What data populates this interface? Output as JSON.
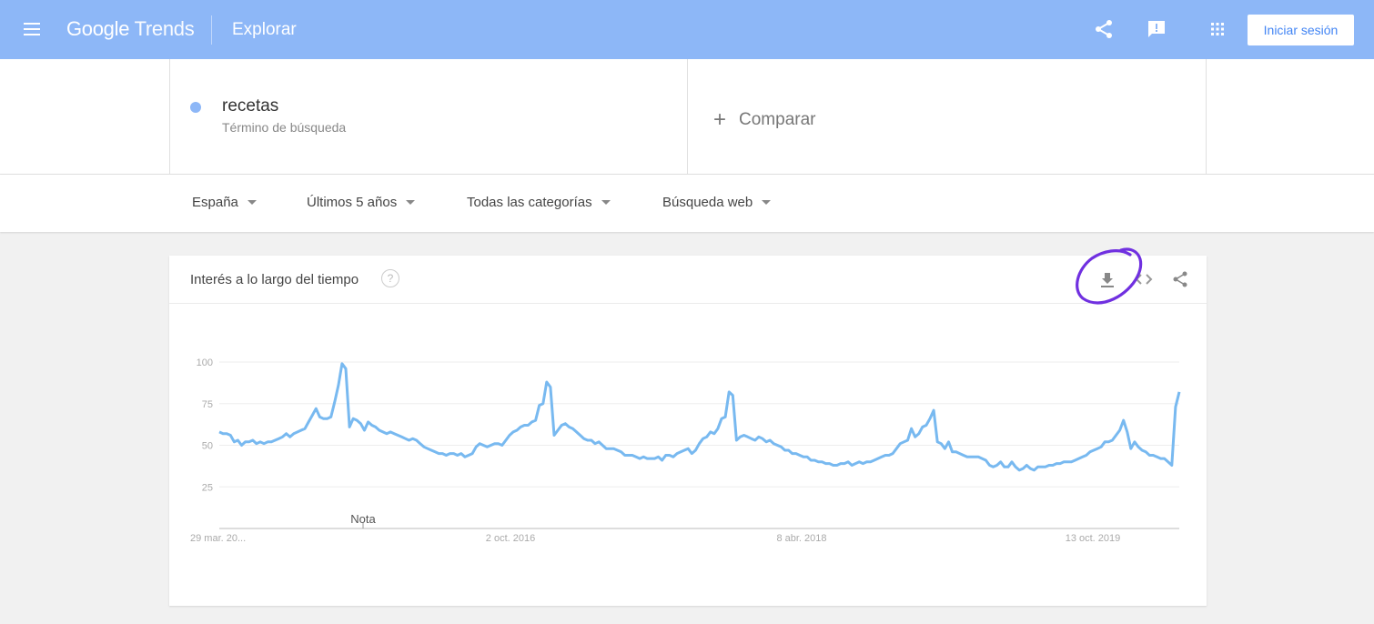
{
  "header": {
    "logo_google": "Google",
    "logo_trends": "Trends",
    "page_title": "Explorar",
    "signin_label": "Iniciar sesión",
    "icons": [
      "menu-icon",
      "share-icon",
      "feedback-icon",
      "apps-icon"
    ]
  },
  "search_term": {
    "name": "recetas",
    "type": "Término de búsqueda",
    "color": "#8db7f7"
  },
  "compare": {
    "plus": "+",
    "label": "Comparar"
  },
  "filters": [
    {
      "label": "España"
    },
    {
      "label": "Últimos 5 años"
    },
    {
      "label": "Todas las categorías"
    },
    {
      "label": "Búsqueda web"
    }
  ],
  "card": {
    "title": "Interés a lo largo del tiempo",
    "help": "?",
    "icons": [
      "download-icon",
      "embed-icon",
      "share-icon"
    ],
    "accent_color": "#7030e0"
  },
  "chart_data": {
    "type": "line",
    "ylim": [
      0,
      100
    ],
    "yticks": [
      25,
      50,
      75,
      100
    ],
    "grid": true,
    "xticks": [
      "29 mar. 20...",
      "2 oct. 2016",
      "8 abr. 2018",
      "13 oct. 2019"
    ],
    "annotation": "Nota",
    "color": "#78b9f0",
    "series": [
      {
        "values": [
          58,
          57,
          57,
          56,
          52,
          53,
          50,
          52,
          52,
          53,
          51,
          52,
          51,
          52,
          52,
          53,
          54,
          55,
          57,
          55,
          57,
          58,
          59,
          60,
          64,
          68,
          72,
          67,
          66,
          66,
          67,
          76,
          86,
          99,
          96,
          61,
          66,
          65,
          63,
          59,
          64,
          62,
          61,
          59,
          58,
          57,
          58,
          57,
          56,
          55,
          54,
          53,
          54,
          53,
          51,
          49,
          48,
          47,
          46,
          45,
          45,
          44,
          45,
          45,
          44,
          45,
          43,
          44,
          45,
          49,
          51,
          50,
          49,
          50,
          51,
          51,
          50,
          53,
          56,
          58,
          59,
          61,
          62,
          62,
          64,
          65,
          74,
          75,
          88,
          85,
          56,
          59,
          62,
          63,
          61,
          60,
          58,
          56,
          54,
          53,
          53,
          51,
          52,
          50,
          48,
          48,
          48,
          47,
          46,
          44,
          44,
          44,
          43,
          42,
          43,
          42,
          42,
          42,
          43,
          41,
          44,
          44,
          43,
          45,
          46,
          47,
          48,
          45,
          47,
          51,
          54,
          55,
          58,
          57,
          60,
          66,
          67,
          82,
          80,
          53,
          55,
          56,
          55,
          54,
          53,
          55,
          54,
          52,
          53,
          51,
          50,
          49,
          47,
          47,
          45,
          45,
          44,
          43,
          43,
          41,
          41,
          40,
          40,
          39,
          39,
          38,
          38,
          39,
          39,
          40,
          38,
          39,
          40,
          39,
          40,
          40,
          41,
          42,
          43,
          44,
          44,
          45,
          48,
          51,
          52,
          53,
          60,
          55,
          57,
          61,
          62,
          66,
          71,
          52,
          51,
          48,
          52,
          46,
          46,
          45,
          44,
          43,
          43,
          43,
          43,
          42,
          41,
          38,
          37,
          38,
          40,
          37,
          37,
          40,
          37,
          35,
          36,
          38,
          36,
          35,
          37,
          37,
          37,
          38,
          38,
          39,
          39,
          40,
          40,
          40,
          41,
          42,
          43,
          44,
          46,
          47,
          48,
          49,
          52,
          52,
          53,
          56,
          59,
          65,
          58,
          48,
          52,
          49,
          47,
          46,
          44,
          44,
          43,
          42,
          42,
          40,
          38,
          73,
          82
        ]
      }
    ]
  }
}
